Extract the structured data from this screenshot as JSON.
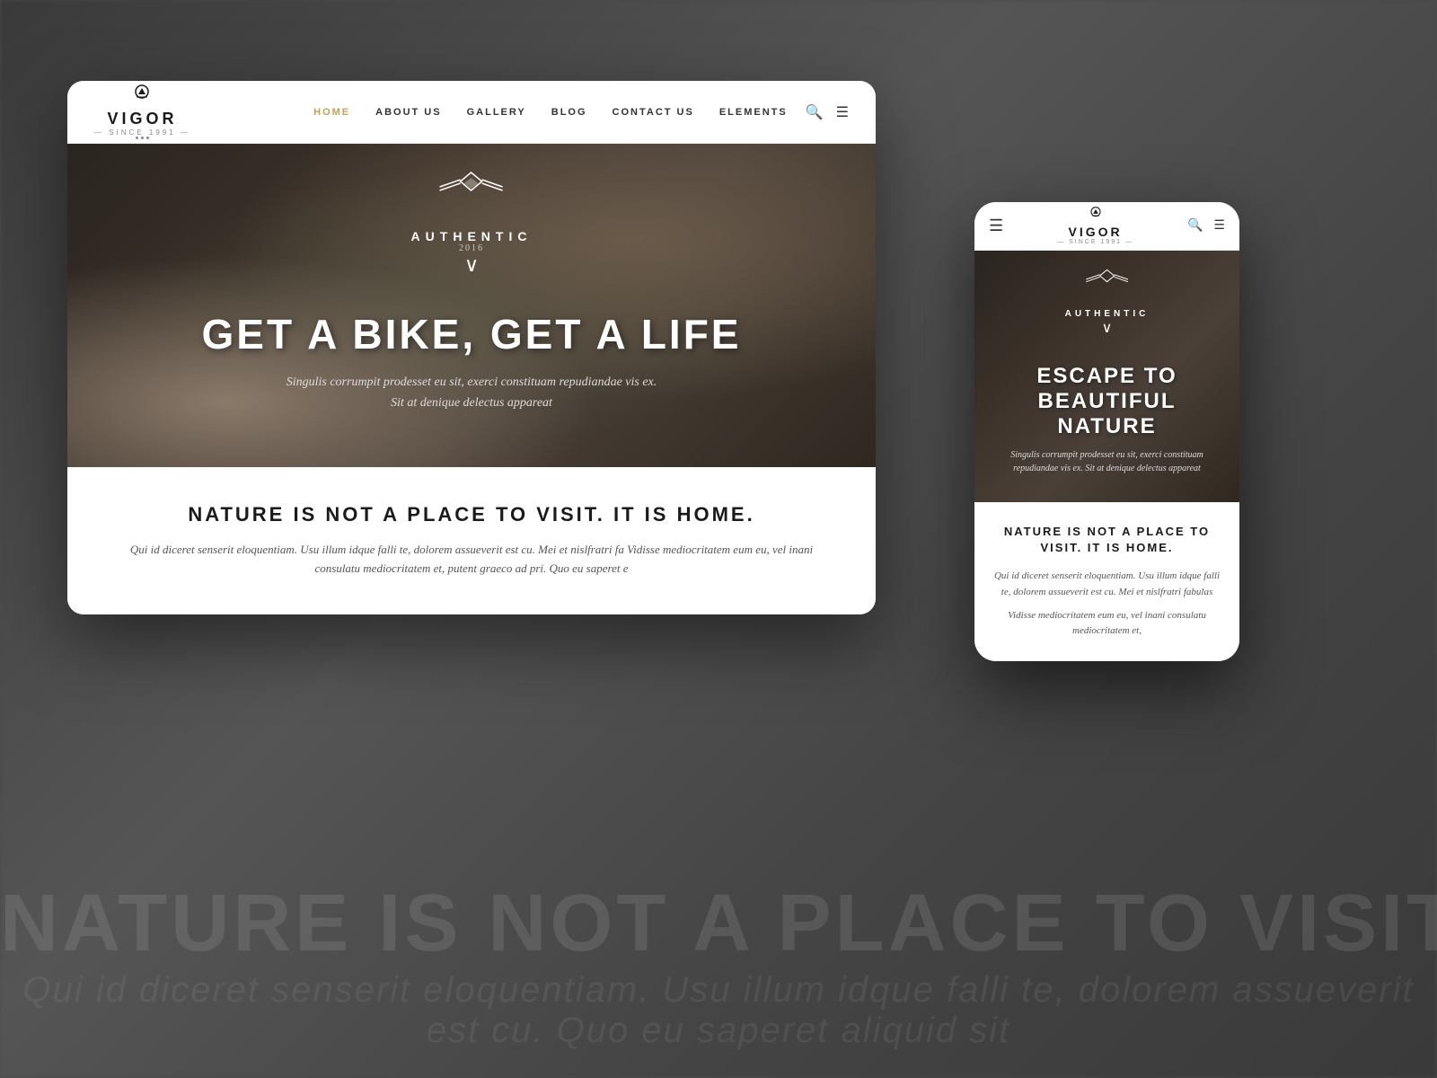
{
  "background": {
    "watermark_text": "NATURE IS NOT A PLACE TO VISIT. IT IS TO",
    "watermark_text2": "Qui id diceret senserit eloquentiam. Usu illum idque falli te, dolorem assueverit est cu. Quo eu saperet aliquid sit"
  },
  "desktop": {
    "nav": {
      "logo_title": "VIGOR",
      "logo_since": "— SINCE 1991 —",
      "links": [
        "HOME",
        "ABOUT US",
        "GALLERY",
        "BLOG",
        "CONTACT US",
        "ELEMENTS"
      ]
    },
    "hero": {
      "badge_text": "AUTHENTIC",
      "badge_year": "2016",
      "headline": "GET A BIKE, GET A LIFE",
      "subtext_line1": "Singulis corrumpit prodesset eu sit, exerci constituam repudiandae vis ex.",
      "subtext_line2": "Sit at denique delectus appareat"
    },
    "content": {
      "heading": "NATURE IS NOT A PLACE TO VISIT. IT IS HOME.",
      "body": "Qui id diceret senserit eloquentiam. Usu illum idque falli te, dolorem assueverit est cu. Mei et nislfratri fa Vidisse mediocritatem eum eu, vel inani consulatu mediocritatem et, putent graeco ad pri. Quo eu saperet e"
    }
  },
  "mobile": {
    "nav": {
      "logo_title": "VIGOR",
      "logo_since": "— SINCE 1991 —"
    },
    "hero": {
      "badge_text": "AUTHENTIC",
      "headline": "ESCAPE TO BEAUTIFUL NATURE",
      "subtext": "Singulis corrumpit prodesset eu sit, exerci constituam repudiandae vis ex. Sit at denique delectus appareat"
    },
    "content": {
      "heading": "NATURE IS NOT A PLACE TO VISIT. IT IS HOME.",
      "body1": "Qui id diceret senserit eloquentiam. Usu illum idque falli te, dolorem assueverit est cu. Mei et nislfratri fabulas",
      "body2": "Vidisse mediocritatem eum eu, vel inani consulatu mediocritatem et,"
    }
  }
}
